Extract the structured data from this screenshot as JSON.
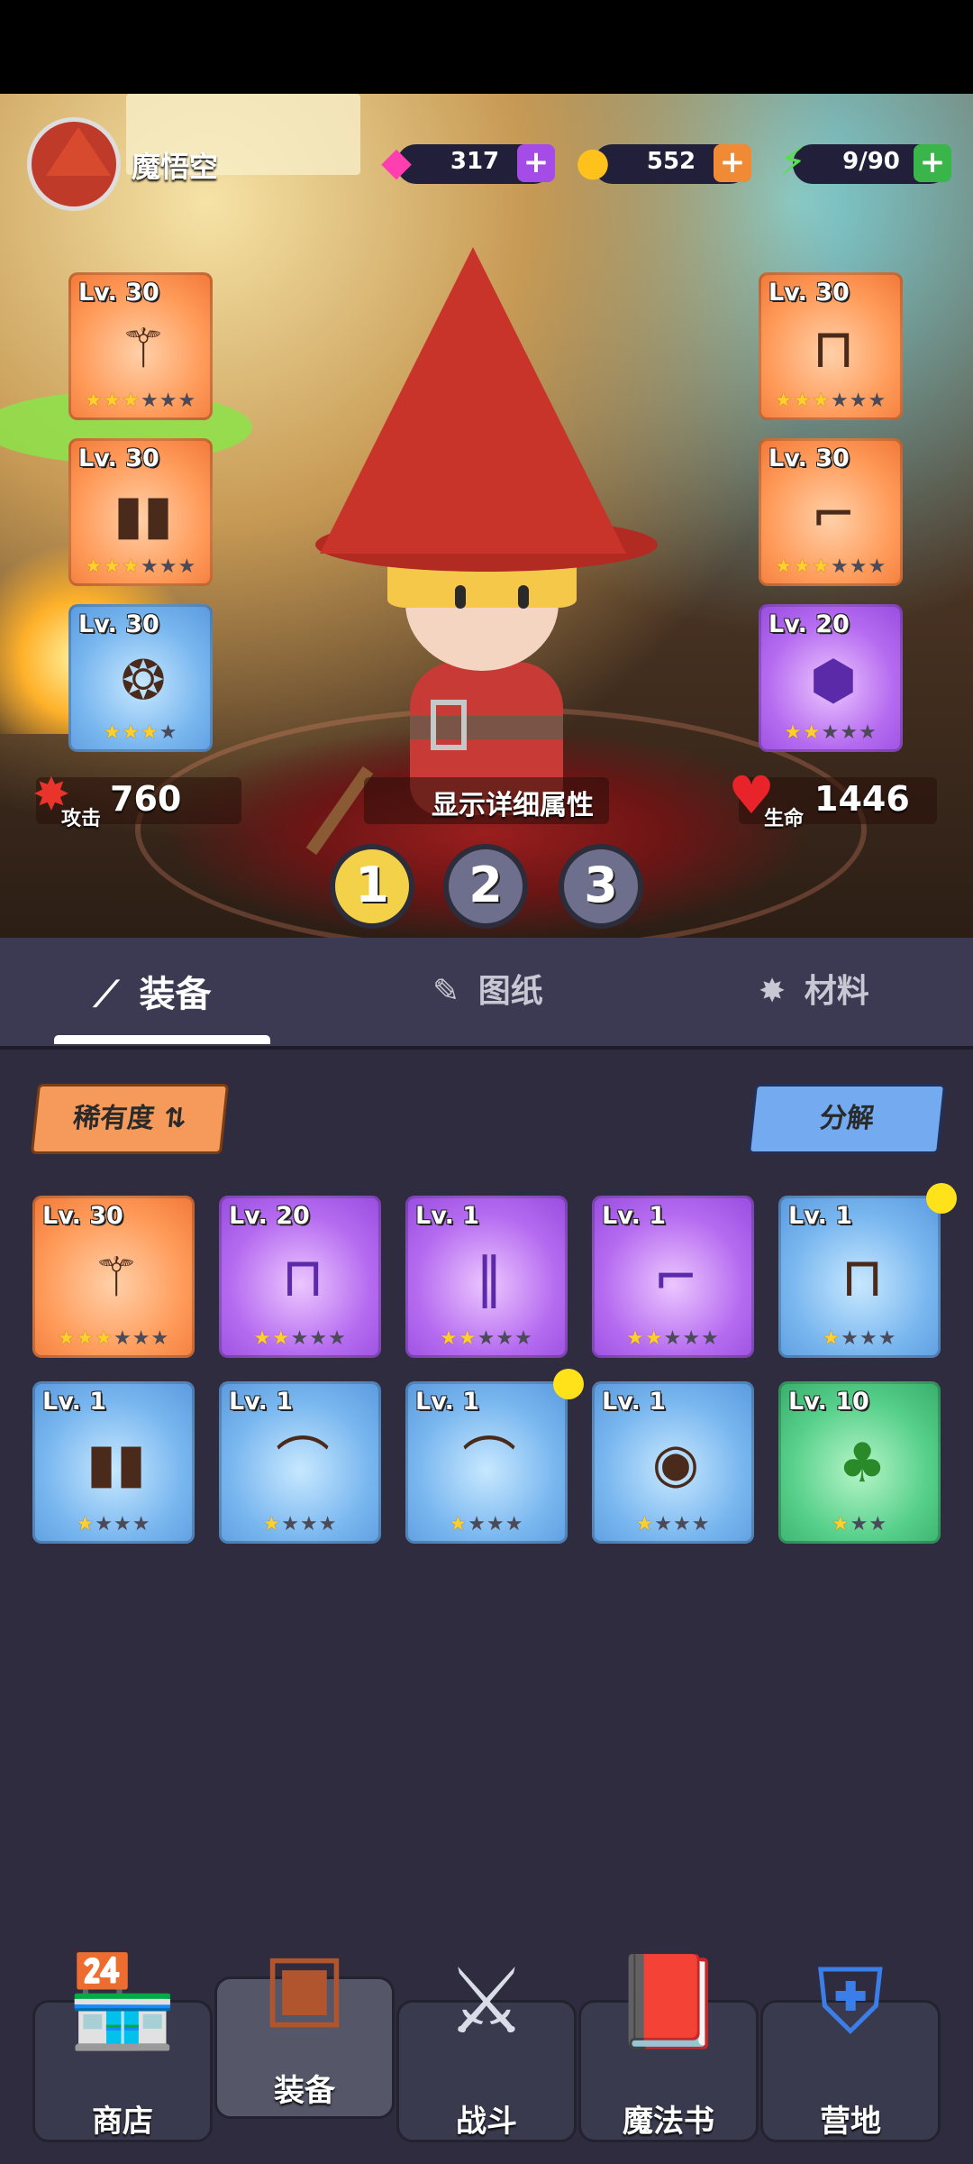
{
  "player": {
    "name": "魔悟空"
  },
  "resources": [
    {
      "name": "gem",
      "value": "317",
      "plus_color": "#a44be8",
      "icon": "gem-icon"
    },
    {
      "name": "gold",
      "value": "552",
      "plus_color": "#f08a34",
      "icon": "coin-icon"
    },
    {
      "name": "energy",
      "value": "9/90",
      "plus_color": "#39b54a",
      "icon": "lightning-icon"
    }
  ],
  "equipped": [
    {
      "level": "Lv. 30",
      "rarity": "orange",
      "stars_on": 3,
      "stars_total": 6,
      "icon": "staff-icon"
    },
    {
      "level": "Lv. 30",
      "rarity": "orange",
      "stars_on": 3,
      "stars_total": 6,
      "icon": "leggings-icon"
    },
    {
      "level": "Lv. 30",
      "rarity": "blue",
      "stars_on": 3,
      "stars_total": 4,
      "icon": "amulet-icon"
    },
    {
      "level": "Lv. 30",
      "rarity": "orange",
      "stars_on": 3,
      "stars_total": 6,
      "icon": "pants-icon"
    },
    {
      "level": "Lv. 30",
      "rarity": "orange",
      "stars_on": 3,
      "stars_total": 6,
      "icon": "boots-icon"
    },
    {
      "level": "Lv. 20",
      "rarity": "purple",
      "stars_on": 2,
      "stars_total": 5,
      "icon": "crystal-icon"
    }
  ],
  "stats": {
    "attack_label": "攻击",
    "attack_value": "760",
    "detail_label": "显示详细属性",
    "hp_label": "生命",
    "hp_value": "1446"
  },
  "loadouts": [
    "1",
    "2",
    "3"
  ],
  "loadout_active": "1",
  "tabs": [
    {
      "label": "装备",
      "icon": "wand-icon",
      "active": true
    },
    {
      "label": "图纸",
      "icon": "scroll-icon",
      "active": false
    },
    {
      "label": "材料",
      "icon": "sparkle-icon",
      "active": false
    }
  ],
  "controls": {
    "sort_label": "稀有度 ⇅",
    "decompose_label": "分解"
  },
  "inventory": [
    {
      "level": "Lv. 30",
      "rarity": "orange",
      "stars_on": 3,
      "stars_total": 6,
      "icon": "staff-icon",
      "dot": false
    },
    {
      "level": "Lv. 20",
      "rarity": "purple",
      "stars_on": 2,
      "stars_total": 5,
      "icon": "pants-icon",
      "dot": false
    },
    {
      "level": "Lv. 1",
      "rarity": "purple",
      "stars_on": 2,
      "stars_total": 5,
      "icon": "greaves-icon",
      "dot": false
    },
    {
      "level": "Lv. 1",
      "rarity": "purple",
      "stars_on": 2,
      "stars_total": 5,
      "icon": "boots-icon",
      "dot": false
    },
    {
      "level": "Lv. 1",
      "rarity": "blue",
      "stars_on": 1,
      "stars_total": 4,
      "icon": "pants-icon",
      "dot": true
    },
    {
      "level": "Lv. 1",
      "rarity": "blue",
      "stars_on": 1,
      "stars_total": 4,
      "icon": "leggings-icon",
      "dot": false
    },
    {
      "level": "Lv. 1",
      "rarity": "blue",
      "stars_on": 1,
      "stars_total": 4,
      "icon": "shoes-icon",
      "dot": false
    },
    {
      "level": "Lv. 1",
      "rarity": "blue",
      "stars_on": 1,
      "stars_total": 4,
      "icon": "shoes-icon",
      "dot": true
    },
    {
      "level": "Lv. 1",
      "rarity": "blue",
      "stars_on": 1,
      "stars_total": 4,
      "icon": "coin-token-icon",
      "dot": false
    },
    {
      "level": "Lv. 10",
      "rarity": "green",
      "stars_on": 1,
      "stars_total": 3,
      "icon": "clover-icon",
      "dot": false
    }
  ],
  "nav": [
    {
      "label": "商店",
      "icon": "shop-icon",
      "active": false
    },
    {
      "label": "装备",
      "icon": "chest-icon",
      "active": true
    },
    {
      "label": "战斗",
      "icon": "swords-icon",
      "active": false
    },
    {
      "label": "魔法书",
      "icon": "spellbook-icon",
      "active": false
    },
    {
      "label": "营地",
      "icon": "shield-icon",
      "active": false
    }
  ],
  "colors": {
    "background": "#2e2c3e",
    "tab_bar": "#3c3a52",
    "sort_button": "#f59a5a",
    "decompose_button": "#74aaf0"
  }
}
